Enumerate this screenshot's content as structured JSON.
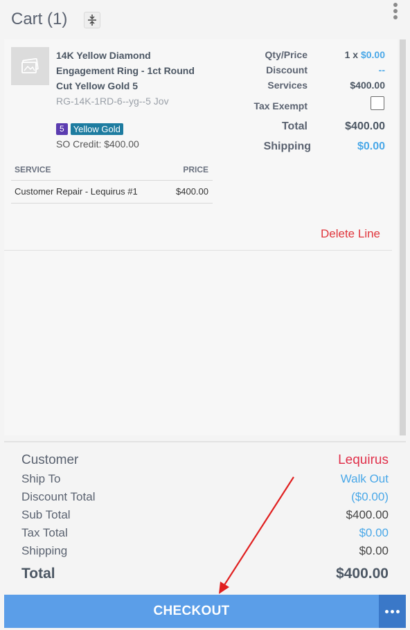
{
  "header": {
    "title": "Cart (1)"
  },
  "item": {
    "name": "14K Yellow Diamond Engagement Ring - 1ct Round Cut Yellow Gold 5",
    "sku": "RG-14K-1RD-6--yg--5 Jov",
    "badge_size": "5",
    "badge_metal": "Yellow Gold",
    "so_credit": "SO Credit: $400.00",
    "qty_price_label": "Qty/Price",
    "qty_prefix": "1 x",
    "qty_price": "$0.00",
    "discount_label": "Discount",
    "discount_value": "--",
    "services_label": "Services",
    "services_value": "$400.00",
    "tax_exempt_label": "Tax Exempt",
    "total_label": "Total",
    "total_value": "$400.00",
    "shipping_label": "Shipping",
    "shipping_value": "$0.00",
    "delete_label": "Delete Line"
  },
  "services_table": {
    "headers": [
      "SERVICE",
      "PRICE"
    ],
    "rows": [
      {
        "service": "Customer Repair - Lequirus #1",
        "price": "$400.00"
      }
    ]
  },
  "totals": {
    "customer_label": "Customer",
    "customer_value": "Lequirus",
    "ship_to_label": "Ship To",
    "ship_to_value": "Walk Out",
    "discount_total_label": "Discount Total",
    "discount_total_value": "($0.00)",
    "sub_total_label": "Sub Total",
    "sub_total_value": "$400.00",
    "tax_total_label": "Tax Total",
    "tax_total_value": "$0.00",
    "shipping_label": "Shipping",
    "shipping_value": "$0.00",
    "total_label": "Total",
    "total_value": "$400.00"
  },
  "checkout": {
    "label": "CHECKOUT"
  },
  "colors": {
    "accent": "#5b9ee8",
    "link": "#4aa8e8",
    "danger": "#e0353b",
    "annotation": "#e02020"
  }
}
